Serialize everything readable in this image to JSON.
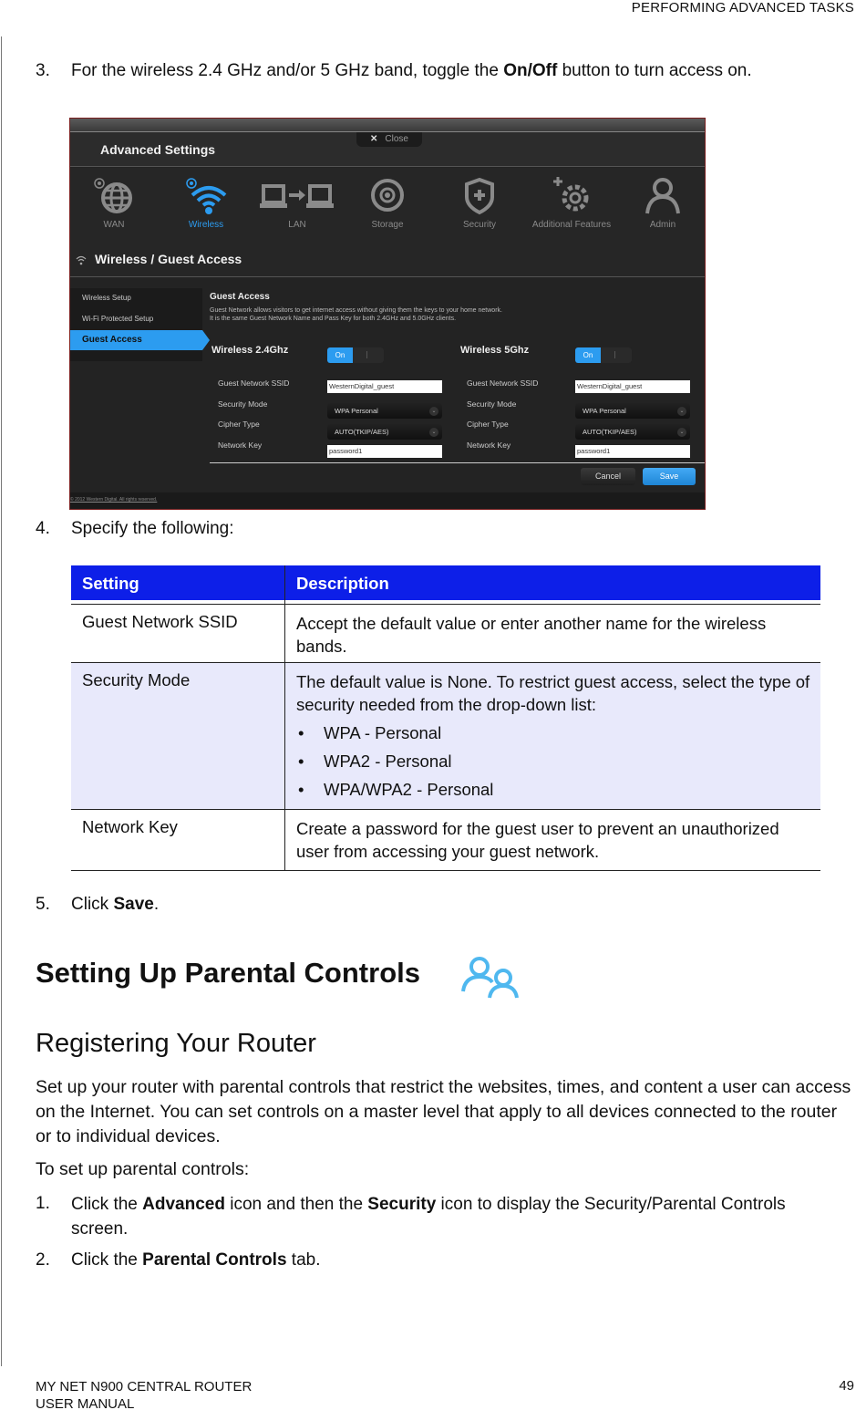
{
  "running_header": "PERFORMING ADVANCED TASKS",
  "steps": {
    "s3": {
      "num": "3.",
      "pre": "For the wireless 2.4 GHz and/or 5 GHz band, toggle the ",
      "bold": "On/Off",
      "post": " button to turn access on."
    },
    "s4": {
      "num": "4.",
      "text": "Specify the following:"
    },
    "s5": {
      "num": "5.",
      "pre": "Click ",
      "bold": "Save",
      "post": "."
    }
  },
  "screenshot": {
    "title": "Advanced Settings",
    "close_label": "Close",
    "nav": [
      {
        "label": "WAN",
        "icon": "globe-icon"
      },
      {
        "label": "Wireless",
        "icon": "wifi-icon"
      },
      {
        "label": "LAN",
        "icon": "lan-icon"
      },
      {
        "label": "Storage",
        "icon": "disc-icon"
      },
      {
        "label": "Security",
        "icon": "shield-icon"
      },
      {
        "label": "Additional Features",
        "icon": "gear-plus-icon"
      },
      {
        "label": "Admin",
        "icon": "user-icon"
      }
    ],
    "section_title": "Wireless / Guest Access",
    "sidebar": [
      "Wireless Setup",
      "Wi-Fi Protected Setup",
      "Guest Access"
    ],
    "guest_access_title": "Guest Access",
    "guest_access_desc_1": "Guest Network allows visitors to get internet access without giving them the keys to your home network.",
    "guest_access_desc_2": "It is the same Guest Network Name and Pass Key for both 2.4GHz and 5.0GHz clients.",
    "bands": [
      {
        "title": "Wireless 2.4Ghz",
        "toggle_on": "On",
        "ssid": "WesternDigital_guest",
        "security": "WPA Personal",
        "cipher": "AUTO(TKIP/AES)",
        "key": "password1"
      },
      {
        "title": "Wireless 5Ghz",
        "toggle_on": "On",
        "ssid": "WesternDigital_guest",
        "security": "WPA Personal",
        "cipher": "AUTO(TKIP/AES)",
        "key": "password1"
      }
    ],
    "field_labels": {
      "ssid": "Guest Network SSID",
      "security": "Security Mode",
      "cipher": "Cipher Type",
      "key": "Network Key"
    },
    "cancel": "Cancel",
    "save": "Save",
    "copyright": "© 2012 Western Digital. All rights reserved."
  },
  "table": {
    "headers": [
      "Setting",
      "Description"
    ],
    "rows": [
      {
        "setting": "Guest Network SSID",
        "description": "Accept the default value or enter another name for the wireless bands."
      },
      {
        "setting": "Security Mode",
        "description": "The default value is None. To restrict guest access, select the type of security needed from the drop-down list:",
        "bullets": [
          "WPA - Personal",
          "WPA2 - Personal",
          "WPA/WPA2 - Personal"
        ]
      },
      {
        "setting": "Network Key",
        "description": "Create a password for the guest user to prevent an unauthorized user from accessing your guest network."
      }
    ]
  },
  "heading1": "Setting Up Parental Controls",
  "heading2": "Registering Your Router",
  "intro": "Set up your router with parental controls that restrict the websites, times, and content a user can access on the Internet. You can set controls on a master level that apply to all devices connected to the router or to individual devices.",
  "lead": "To set up parental controls:",
  "pc_steps": {
    "s1": {
      "num": "1.",
      "pre": "Click the ",
      "b1": "Advanced",
      "mid": " icon and then the ",
      "b2": "Security",
      "post": " icon to display the Security/Parental Controls screen."
    },
    "s2": {
      "num": "2.",
      "pre": "Click the ",
      "b1": "Parental Controls",
      "post": " tab."
    }
  },
  "footer": {
    "line1": "MY NET N900 CENTRAL ROUTER",
    "line2": "USER MANUAL",
    "page": "49"
  },
  "colors": {
    "accent_blue": "#2c9cf0",
    "table_header": "#0d1fe8",
    "table_shade": "#e8e9fb"
  }
}
